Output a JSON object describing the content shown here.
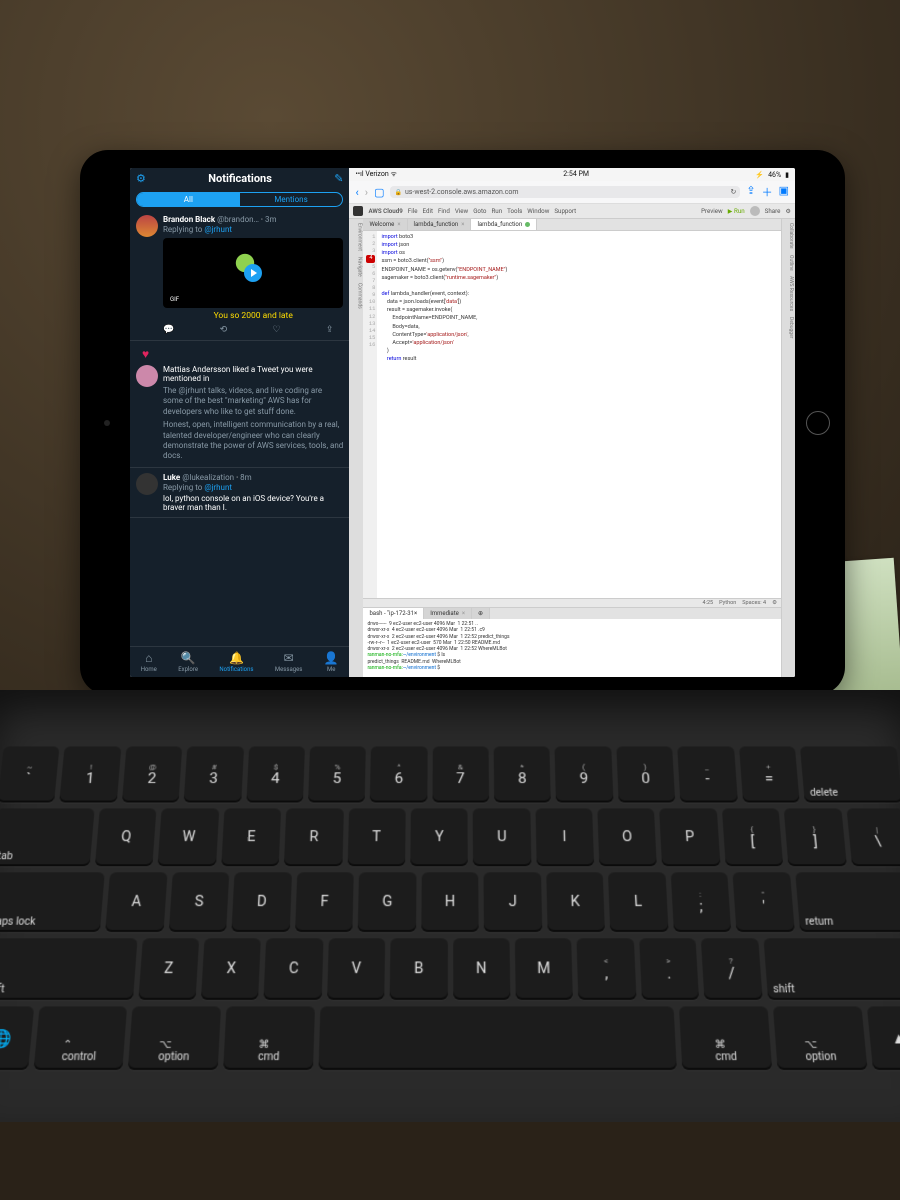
{
  "ios_status": {
    "carrier": "Verizon",
    "time": "2:54 PM",
    "battery": "46%"
  },
  "twitter": {
    "title": "Notifications",
    "tabs": {
      "all": "All",
      "mentions": "Mentions"
    },
    "gif_badge": "GIF",
    "item1": {
      "name": "Brandon Black",
      "handle": "@brandon…",
      "time": "3m",
      "replying": "Replying to ",
      "reply_target": "@jrhunt",
      "caption": "You so 2000 and late"
    },
    "like": {
      "lead": "Mattias Andersson",
      "rest": " liked a Tweet you were mentioned in",
      "para1": "The @jrhunt talks, videos, and live coding are some of the best \"marketing\" AWS has for developers who like to get stuff done.",
      "para2": "Honest, open, intelligent communication by a real, talented developer/engineer who can clearly demonstrate the power of AWS services, tools, and docs."
    },
    "item2": {
      "name": "Luke",
      "handle": "@lukealization",
      "time": "8m",
      "replying": "Replying to ",
      "reply_target": "@jrhunt",
      "text": "lol, python console on an iOS device? You're a braver man than I."
    },
    "nav": {
      "home": "Home",
      "explore": "Explore",
      "notifications": "Notifications",
      "messages": "Messages",
      "me": "Me"
    }
  },
  "safari": {
    "url": "us-west-2.console.aws.amazon.com"
  },
  "cloud9": {
    "menu": {
      "brand": "AWS Cloud9",
      "file": "File",
      "edit": "Edit",
      "find": "Find",
      "view": "View",
      "goto": "Goto",
      "run": "Run",
      "tools": "Tools",
      "window": "Window",
      "support": "Support",
      "preview": "Preview",
      "run_btn": "Run",
      "share": "Share"
    },
    "left_rail": {
      "env": "Environment",
      "nav": "Navigate",
      "cmd": "Commands"
    },
    "right_rail": {
      "collab": "Collaborate",
      "outline": "Outline",
      "aws": "AWS Resources",
      "debug": "Debugger"
    },
    "tabs": {
      "welcome": "Welcome",
      "lambda1": "lambda_function",
      "lambda2": "lambda_function"
    },
    "code": {
      "l1a": "import",
      "l1b": " boto3",
      "l2a": "import",
      "l2b": " json",
      "l3a": "import",
      "l3b": " os",
      "l4a": "ssm = boto3.client(",
      "l4b": "\"ssm\"",
      "l4c": ")",
      "l5a": "ENDPOINT_NAME = os.getenv(",
      "l5b": "\"ENDPOINT_NAME\"",
      "l5c": ")",
      "l6a": "sagemaker = boto3.client(",
      "l6b": "\"runtime.sagemaker\"",
      "l6c": ")",
      "l7": "",
      "l8a": "def",
      "l8b": " lambda_handler(event, context):",
      "l9a": "    data = json.loads(event[",
      "l9b": "'data'",
      "l9c": "])",
      "l10": "    result = sagemaker.invoke(",
      "l11": "        EndpointName=ENDPOINT_NAME,",
      "l12": "        Body=data,",
      "l13a": "        ContentType=",
      "l13b": "'application/json'",
      "l13c": ",",
      "l14a": "        Accept=",
      "l14b": "'application/json'",
      "l15": "    )",
      "l16a": "    return",
      "l16b": " result"
    },
    "status": {
      "pos": "4:25",
      "lang": "Python",
      "spaces": "Spaces: 4"
    },
    "term_tabs": {
      "bash": "bash - \"ip-172-31×",
      "immediate": "Immediate"
    },
    "term": {
      "l1": "drwx------  9 ec2-user ec2-user 4096 Mar  1 22:51 ..",
      "l2": "drwxr-xr-x  4 ec2-user ec2-user 4096 Mar  1 22:51 .c9",
      "l3": "drwxr-xr-x  2 ec2-user ec2-user 4096 Mar  1 22:52 predict_things",
      "l4": "-rw-r--r--  1 ec2-user ec2-user  570 Mar  1 22:50 README.md",
      "l5": "drwxr-xr-x  2 ec2-user ec2-user 4096 Mar  1 22:52 WhereMLBot",
      "p1a": "ranman-no-mfa:",
      "p1b": "~/environment",
      "p1c": " $ ls",
      "l6": "predict_things  README.md  WhereMLBot",
      "p2a": "ranman-no-mfa:",
      "p2b": "~/environment",
      "p2c": " $"
    }
  },
  "keys": {
    "row0": {
      "delete": "delete"
    },
    "row1": {
      "tab": "tab"
    },
    "row2": {
      "caps": "caps lock",
      "return": "return"
    },
    "row3": {
      "shift_l": "shift",
      "shift_r": "shift"
    },
    "row4": {
      "globe": "🌐",
      "ctrl": "control",
      "opt_l": "option",
      "cmd_l": "cmd",
      "cmd_r": "cmd",
      "opt_r": "option"
    },
    "numsyms": [
      "~`",
      "!1",
      "@2",
      "#3",
      "$4",
      "%5",
      "^6",
      "&7",
      "*8",
      "(9",
      ")0",
      "_-",
      "+="
    ],
    "qwerty": [
      "Q",
      "W",
      "E",
      "R",
      "T",
      "Y",
      "U",
      "I",
      "O",
      "P"
    ],
    "brackets": [
      "{[",
      "}]",
      "|\\"
    ],
    "asdf": [
      "A",
      "S",
      "D",
      "F",
      "G",
      "H",
      "J",
      "K",
      "L"
    ],
    "semis": [
      ":;",
      "\"'"
    ],
    "zxcv": [
      "Z",
      "X",
      "C",
      "V",
      "B",
      "N",
      "M"
    ],
    "punct": [
      "<,",
      ">.",
      "?/"
    ]
  }
}
